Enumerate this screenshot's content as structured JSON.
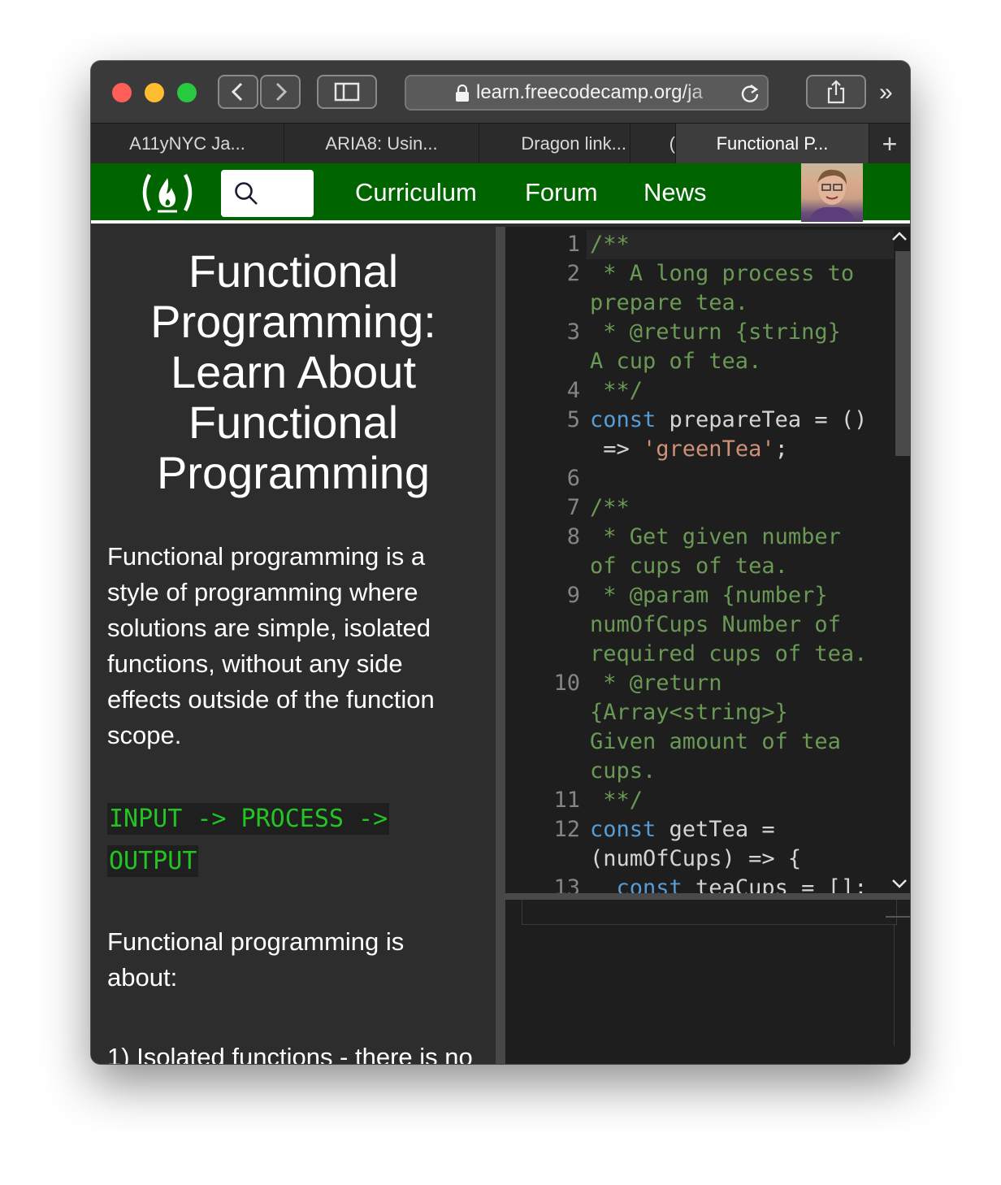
{
  "browser": {
    "address": "learn.freecodecamp.org/ja",
    "tabs": [
      {
        "label": "A11yNYC Ja..."
      },
      {
        "label": "ARIA8: Usin..."
      },
      {
        "label": "Dragon link..."
      },
      {
        "label": "("
      },
      {
        "label": "Functional P..."
      }
    ],
    "new_tab_label": "+",
    "overflow_label": "»"
  },
  "nav": {
    "logo": "(🔥)",
    "links": [
      "Curriculum",
      "Forum",
      "News"
    ]
  },
  "lesson": {
    "title": "Functional Programming: Learn About Functional Programming",
    "paragraph1": "Functional programming is a style of programming where solutions are simple, isolated functions, without any side effects outside of the function scope.",
    "code_line1": "INPUT -> PROCESS ->",
    "code_line2": "OUTPUT",
    "paragraph2": "Functional programming is about:",
    "paragraph3": "1) Isolated functions - there is no"
  },
  "editor": {
    "line_numbers": [
      "1",
      "2",
      "3",
      "4",
      "5",
      "6",
      "7",
      "8",
      "9",
      "10",
      "11",
      "12",
      "13"
    ]
  },
  "colors": {
    "nav_green": "#006400",
    "comment": "#6a9955",
    "keyword": "#569cd6",
    "string": "#ce9178",
    "code_green": "#22c522"
  }
}
